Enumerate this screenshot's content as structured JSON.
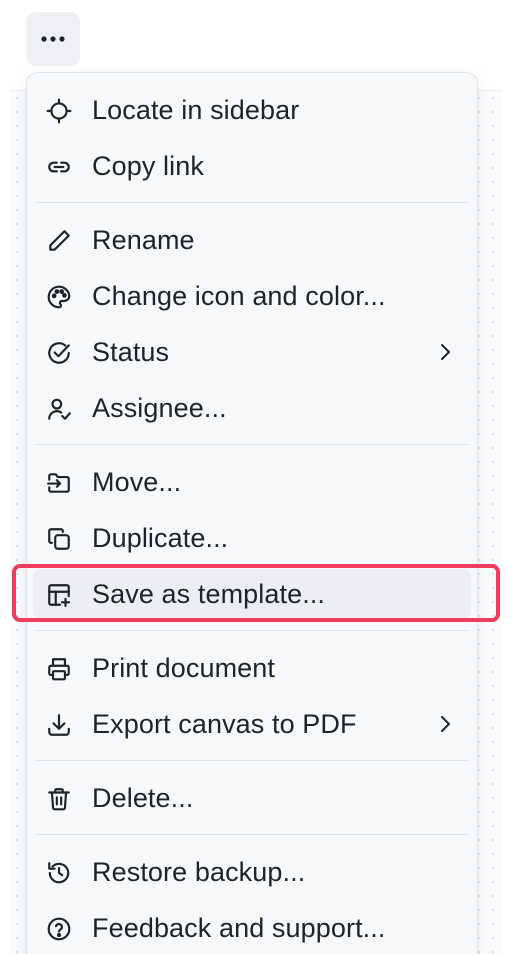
{
  "more_button": {
    "icon": "more-horizontal-icon"
  },
  "menu": {
    "items": [
      {
        "label": "Locate in sidebar",
        "icon": "crosshair-icon"
      },
      {
        "label": "Copy link",
        "icon": "link-icon"
      },
      {
        "label": "Rename",
        "icon": "pencil-icon"
      },
      {
        "label": "Change icon and color...",
        "icon": "palette-icon"
      },
      {
        "label": "Status",
        "icon": "check-circle-icon",
        "submenu": true
      },
      {
        "label": "Assignee...",
        "icon": "user-check-icon"
      },
      {
        "label": "Move...",
        "icon": "folder-move-icon"
      },
      {
        "label": "Duplicate...",
        "icon": "copy-icon"
      },
      {
        "label": "Save as template...",
        "icon": "template-add-icon",
        "highlighted": true
      },
      {
        "label": "Print document",
        "icon": "printer-icon"
      },
      {
        "label": "Export canvas to PDF",
        "icon": "download-icon",
        "submenu": true
      },
      {
        "label": "Delete...",
        "icon": "trash-icon"
      },
      {
        "label": "Restore backup...",
        "icon": "history-icon"
      },
      {
        "label": "Feedback and support...",
        "icon": "help-circle-icon"
      }
    ]
  },
  "colors": {
    "highlight_border": "#ee3d5f",
    "menu_background": "#f7f8fa",
    "text": "#1f2329"
  }
}
